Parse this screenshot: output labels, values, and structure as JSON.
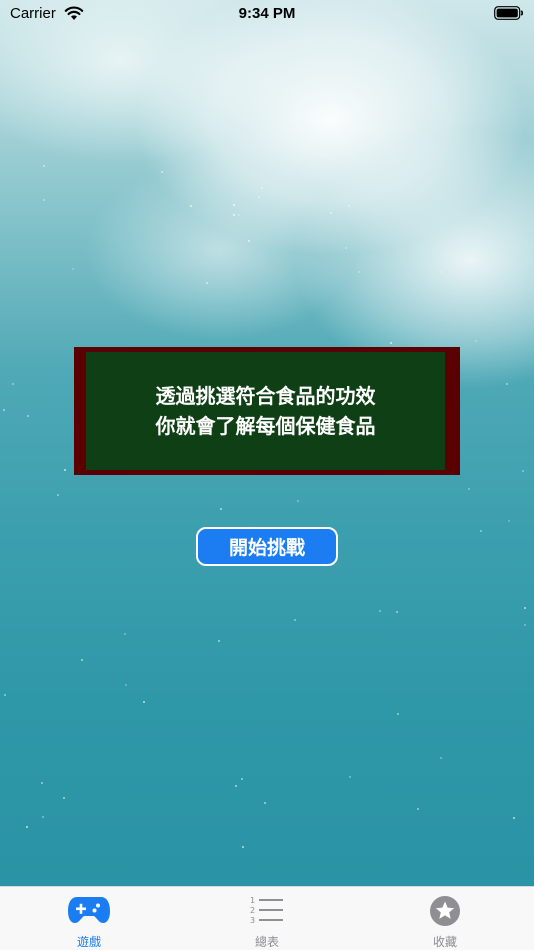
{
  "status_bar": {
    "carrier": "Carrier",
    "time": "9:34 PM"
  },
  "panel": {
    "line1": "透過挑選符合食品的功效",
    "line2": "你就會了解每個保健食品"
  },
  "start_button": {
    "label": "開始挑戰"
  },
  "tabs": [
    {
      "label": "遊戲",
      "icon": "gamepad-icon",
      "active": true
    },
    {
      "label": "總表",
      "icon": "numbered-list-icon",
      "active": false
    },
    {
      "label": "收藏",
      "icon": "star-icon",
      "active": false
    }
  ],
  "colors": {
    "accent": "#1c7df2",
    "panel_border": "#5a0000",
    "panel_fill": "#0f3f14",
    "inactive_tab": "#8e8e93"
  }
}
